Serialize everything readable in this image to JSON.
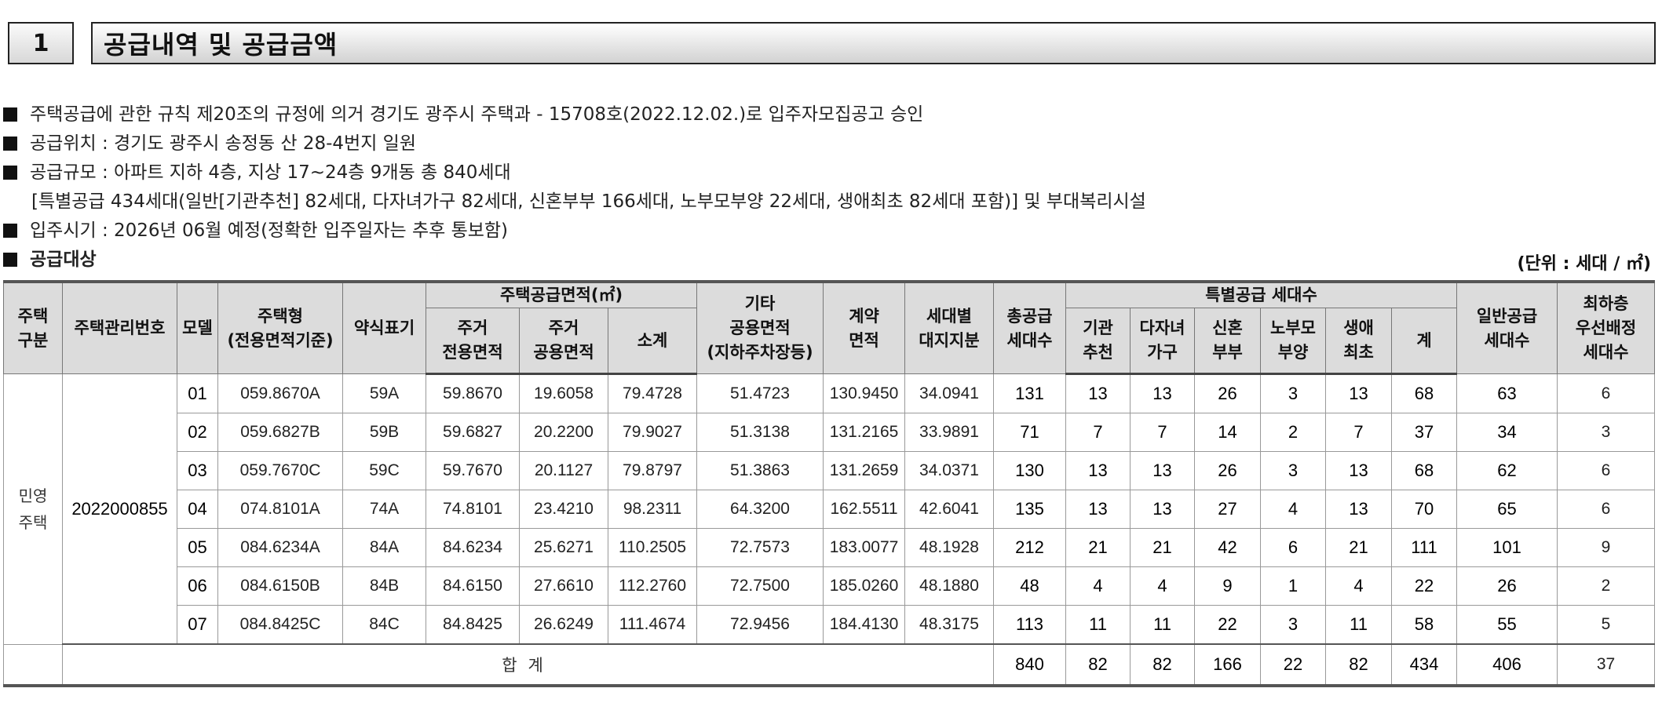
{
  "section": {
    "number": "1",
    "title": "공급내역 및 공급금액"
  },
  "notes": [
    "주택공급에 관한 규칙 제20조의 규정에 의거 경기도 광주시 주택과 - 15708호(2022.12.02.)로 입주자모집공고 승인",
    "공급위치 : 경기도 광주시 송정동 산 28-4번지 일원",
    "공급규모 : 아파트 지하 4층, 지상 17~24층 9개동 총 840세대",
    "[특별공급 434세대(일반[기관추천] 82세대, 다자녀가구 82세대, 신혼부부 166세대, 노부모부양 22세대, 생애최초 82세대 포함)] 및 부대복리시설",
    "입주시기 : 2026년 06월 예정(정확한 입주일자는 추후 통보함)",
    "공급대상"
  ],
  "unit": "(단위 : 세대 / ㎡)",
  "headers": {
    "housing_type": [
      "주택",
      "구분"
    ],
    "mgmt_no": "주택관리번호",
    "model": "모델",
    "house_type": [
      "주택형",
      "(전용면적기준)"
    ],
    "abbr": "약식표기",
    "supply_area": "주택공급면적(㎡)",
    "exclusive": [
      "주거",
      "전용면적"
    ],
    "common": [
      "주거",
      "공용면적"
    ],
    "subtotal": "소계",
    "other_common": [
      "기타",
      "공용면적",
      "(지하주차장등)"
    ],
    "contract_area": [
      "계약",
      "면적"
    ],
    "land_share": [
      "세대별",
      "대지지분"
    ],
    "total_supply": [
      "총공급",
      "세대수"
    ],
    "special": "특별공급 세대수",
    "institution": [
      "기관",
      "추천"
    ],
    "multi_child": [
      "다자녀",
      "가구"
    ],
    "newlywed": [
      "신혼",
      "부부"
    ],
    "elderly": [
      "노부모",
      "부양"
    ],
    "first_time": [
      "생애",
      "최초"
    ],
    "special_total": "계",
    "general": [
      "일반공급",
      "세대수"
    ],
    "lowest_floor": [
      "최하층",
      "우선배정",
      "세대수"
    ]
  },
  "housing_type": [
    "민영",
    "주택"
  ],
  "mgmt_no": "2022000855",
  "rows": [
    [
      "01",
      "059.8670A",
      "59A",
      "59.8670",
      "19.6058",
      "79.4728",
      "51.4723",
      "130.9450",
      "34.0941",
      "131",
      "13",
      "13",
      "26",
      "3",
      "13",
      "68",
      "63",
      "6"
    ],
    [
      "02",
      "059.6827B",
      "59B",
      "59.6827",
      "20.2200",
      "79.9027",
      "51.3138",
      "131.2165",
      "33.9891",
      "71",
      "7",
      "7",
      "14",
      "2",
      "7",
      "37",
      "34",
      "3"
    ],
    [
      "03",
      "059.7670C",
      "59C",
      "59.7670",
      "20.1127",
      "79.8797",
      "51.3863",
      "131.2659",
      "34.0371",
      "130",
      "13",
      "13",
      "26",
      "3",
      "13",
      "68",
      "62",
      "6"
    ],
    [
      "04",
      "074.8101A",
      "74A",
      "74.8101",
      "23.4210",
      "98.2311",
      "64.3200",
      "162.5511",
      "42.6041",
      "135",
      "13",
      "13",
      "27",
      "4",
      "13",
      "70",
      "65",
      "6"
    ],
    [
      "05",
      "084.6234A",
      "84A",
      "84.6234",
      "25.6271",
      "110.2505",
      "72.7573",
      "183.0077",
      "48.1928",
      "212",
      "21",
      "21",
      "42",
      "6",
      "21",
      "111",
      "101",
      "9"
    ],
    [
      "06",
      "084.6150B",
      "84B",
      "84.6150",
      "27.6610",
      "112.2760",
      "72.7500",
      "185.0260",
      "48.1880",
      "48",
      "4",
      "4",
      "9",
      "1",
      "4",
      "22",
      "26",
      "2"
    ],
    [
      "07",
      "084.8425C",
      "84C",
      "84.8425",
      "26.6249",
      "111.4674",
      "72.9456",
      "184.4130",
      "48.3175",
      "113",
      "11",
      "11",
      "22",
      "3",
      "11",
      "58",
      "55",
      "5"
    ]
  ],
  "totals": {
    "label": "합계",
    "values": [
      "840",
      "82",
      "82",
      "166",
      "22",
      "82",
      "434",
      "406",
      "37"
    ]
  }
}
